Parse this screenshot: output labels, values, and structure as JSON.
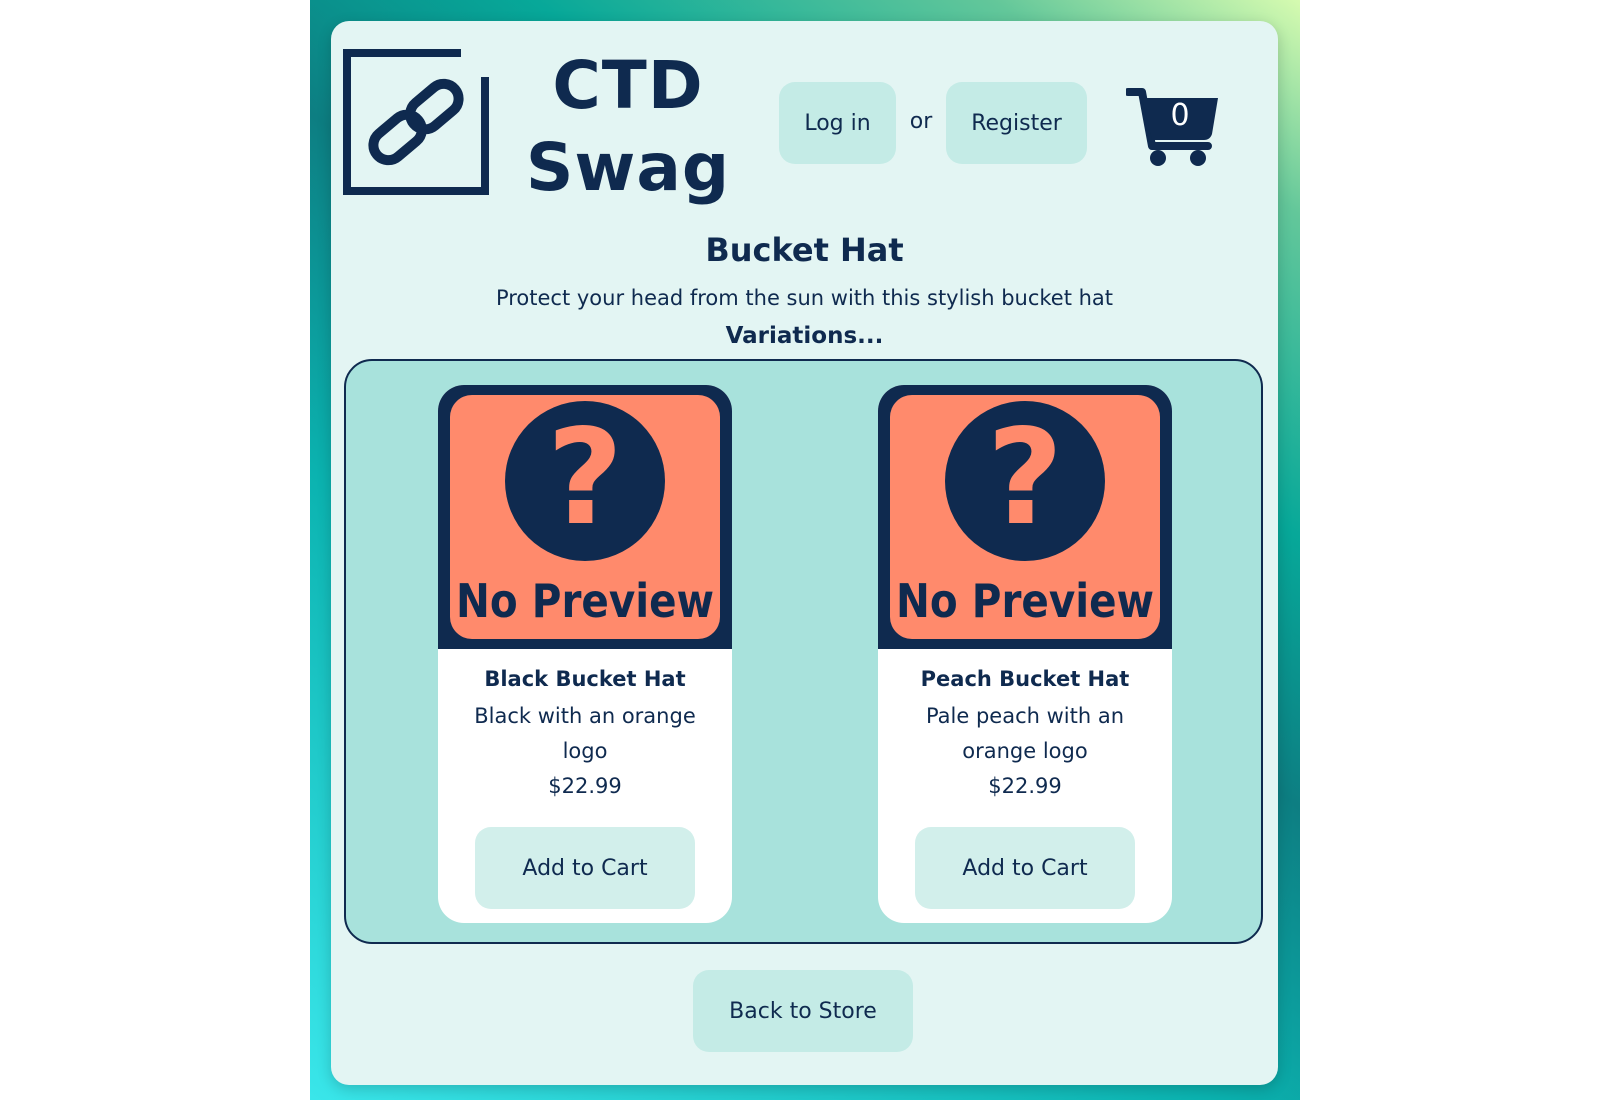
{
  "header": {
    "brand_line1": "CTD",
    "brand_line2": "Swag",
    "login_label": "Log in",
    "or_label": "or",
    "register_label": "Register",
    "cart_count": "0"
  },
  "product": {
    "title": "Bucket Hat",
    "description": "Protect your head from the sun with this stylish bucket hat",
    "variations_label": "Variations..."
  },
  "variants": [
    {
      "preview_text": "No Preview",
      "name": "Black Bucket Hat",
      "description": "Black with an orange logo",
      "price": "$22.99",
      "add_label": "Add to Cart"
    },
    {
      "preview_text": "No Preview",
      "name": "Peach Bucket Hat",
      "description": "Pale peach with an orange logo",
      "price": "$22.99",
      "add_label": "Add to Cart"
    }
  ],
  "footer": {
    "back_label": "Back to Store"
  },
  "icons": {
    "logo": "link-icon",
    "cart": "shopping-cart-icon",
    "preview": "question-mark-icon"
  },
  "colors": {
    "navy": "#0f2a4f",
    "card_bg": "#e3f5f3",
    "button_bg": "#c4ebe6",
    "variations_bg": "#a8e2dc",
    "preview_orange": "#ff8a6c"
  }
}
